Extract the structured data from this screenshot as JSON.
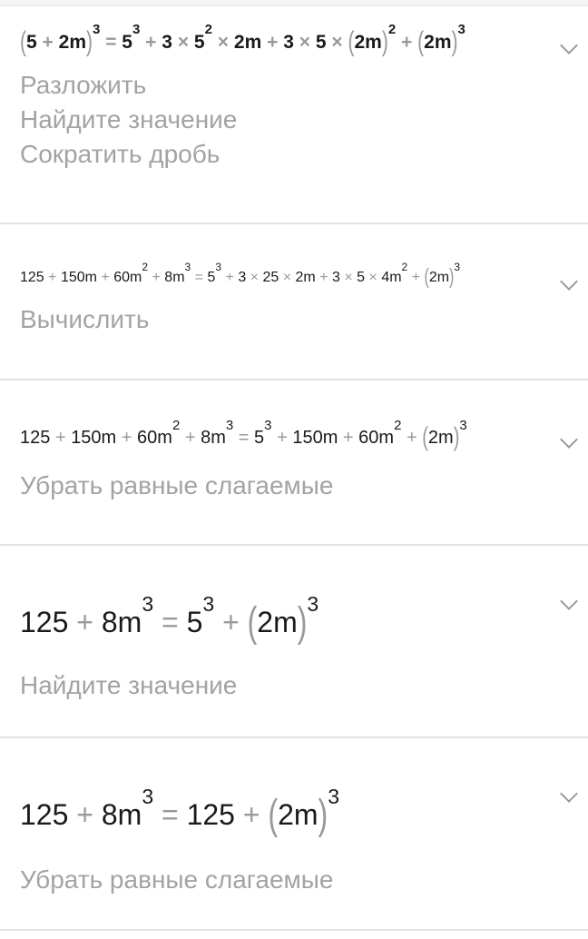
{
  "steps": [
    {
      "expression": [
        "(",
        "5",
        "+",
        "2m",
        ")",
        "3",
        "=",
        "5",
        "3",
        "+",
        "3",
        "×",
        "5",
        "2",
        "×",
        "2m",
        "+",
        "3",
        "×",
        "5",
        "×",
        "(",
        "2m",
        ")",
        "2",
        "+",
        "(",
        "2m",
        ")",
        "3"
      ],
      "actions": [
        "Разложить",
        "Найдите значение",
        "Сократить дробь"
      ]
    },
    {
      "expression": [
        "125",
        "+",
        "150m",
        "+",
        "60m",
        "2",
        "+",
        "8m",
        "3",
        "=",
        "5",
        "3",
        "+",
        "3",
        "×",
        "25",
        "×",
        "2m",
        "+",
        "3",
        "×",
        "5",
        "×",
        "4m",
        "2",
        "+",
        "(",
        "2m",
        ")",
        "3"
      ],
      "actions": [
        "Вычислить"
      ]
    },
    {
      "expression": [
        "125",
        "+",
        "150m",
        "+",
        "60m",
        "2",
        "+",
        "8m",
        "3",
        "=",
        "5",
        "3",
        "+",
        "150m",
        "+",
        "60m",
        "2",
        "+",
        "(",
        "2m",
        ")",
        "3"
      ],
      "actions": [
        "Убрать равные слагаемые"
      ]
    },
    {
      "expression": [
        "125",
        "+",
        "8m",
        "3",
        "=",
        "5",
        "3",
        "+",
        "(",
        "2m",
        ")",
        "3"
      ],
      "actions": [
        "Найдите значение"
      ]
    },
    {
      "expression": [
        "125",
        "+",
        "8m",
        "3",
        "=",
        "125",
        "+",
        "(",
        "2m",
        ")",
        "3"
      ],
      "actions": [
        "Убрать равные слагаемые"
      ]
    }
  ]
}
